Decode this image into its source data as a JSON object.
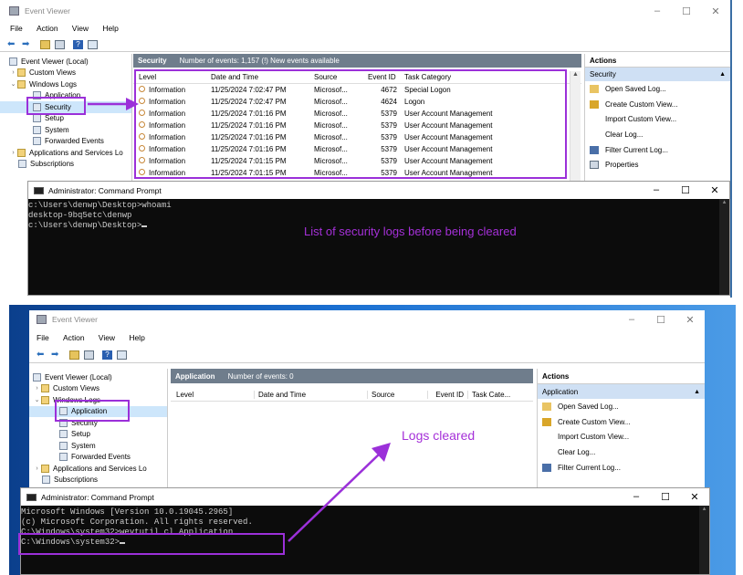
{
  "colors": {
    "accent": "#9b30d9",
    "panel_header": "#6f7d8c",
    "selected": "#cfe0f4",
    "desktop": "#1a6fd1"
  },
  "top": {
    "window_title": "Event Viewer",
    "menu": [
      "File",
      "Action",
      "View",
      "Help"
    ],
    "tree": [
      {
        "label": "Event Viewer (Local)",
        "level": 0
      },
      {
        "label": "Custom Views",
        "level": 1
      },
      {
        "label": "Windows Logs",
        "level": 1
      },
      {
        "label": "Application",
        "level": 2
      },
      {
        "label": "Security",
        "level": 2
      },
      {
        "label": "Setup",
        "level": 2
      },
      {
        "label": "System",
        "level": 2
      },
      {
        "label": "Forwarded Events",
        "level": 2
      },
      {
        "label": "Applications and Services Lo",
        "level": 1
      },
      {
        "label": "Subscriptions",
        "level": 1
      }
    ],
    "panel_name": "Security",
    "panel_info": "Number of events: 1,157 (!) New events available",
    "columns": [
      "Level",
      "Date and Time",
      "Source",
      "Event ID",
      "Task Category"
    ],
    "rows": [
      [
        "Information",
        "11/25/2024 7:02:47 PM",
        "Microsof...",
        "4672",
        "Special Logon"
      ],
      [
        "Information",
        "11/25/2024 7:02:47 PM",
        "Microsof...",
        "4624",
        "Logon"
      ],
      [
        "Information",
        "11/25/2024 7:01:16 PM",
        "Microsof...",
        "5379",
        "User Account Management"
      ],
      [
        "Information",
        "11/25/2024 7:01:16 PM",
        "Microsof...",
        "5379",
        "User Account Management"
      ],
      [
        "Information",
        "11/25/2024 7:01:16 PM",
        "Microsof...",
        "5379",
        "User Account Management"
      ],
      [
        "Information",
        "11/25/2024 7:01:16 PM",
        "Microsof...",
        "5379",
        "User Account Management"
      ],
      [
        "Information",
        "11/25/2024 7:01:15 PM",
        "Microsof...",
        "5379",
        "User Account Management"
      ],
      [
        "Information",
        "11/25/2024 7:01:15 PM",
        "Microsof...",
        "5379",
        "User Account Management"
      ]
    ],
    "actions_title": "Actions",
    "actions_section": "Security",
    "actions": [
      "Open Saved Log...",
      "Create Custom View...",
      "Import Custom View...",
      "Clear Log...",
      "Filter Current Log...",
      "Properties"
    ],
    "cmd_title": "Administrator: Command Prompt",
    "cmd_lines": [
      "",
      "c:\\Users\\denwp\\Desktop>whoami",
      "desktop-9bq5etc\\denwp",
      "",
      "c:\\Users\\denwp\\Desktop>"
    ],
    "annotation": "List of security logs before being cleared"
  },
  "bottom": {
    "window_title": "Event Viewer",
    "menu": [
      "File",
      "Action",
      "View",
      "Help"
    ],
    "tree": [
      {
        "label": "Event Viewer (Local)",
        "level": 0
      },
      {
        "label": "Custom Views",
        "level": 1
      },
      {
        "label": "Windows Logs",
        "level": 1
      },
      {
        "label": "Application",
        "level": 2
      },
      {
        "label": "Security",
        "level": 2
      },
      {
        "label": "Setup",
        "level": 2
      },
      {
        "label": "System",
        "level": 2
      },
      {
        "label": "Forwarded Events",
        "level": 2
      },
      {
        "label": "Applications and Services Lo",
        "level": 1
      },
      {
        "label": "Subscriptions",
        "level": 1
      }
    ],
    "panel_name": "Application",
    "panel_info": "Number of events: 0",
    "columns": [
      "Level",
      "Date and Time",
      "Source",
      "Event ID",
      "Task Cate..."
    ],
    "actions_title": "Actions",
    "actions_section": "Application",
    "actions": [
      "Open Saved Log...",
      "Create Custom View...",
      "Import Custom View...",
      "Clear Log...",
      "Filter Current Log..."
    ],
    "cmd_title": "Administrator: Command Prompt",
    "cmd_lines": [
      "Microsoft Windows [Version 10.0.19045.2965]",
      "(c) Microsoft Corporation. All rights reserved.",
      "",
      "C:\\Windows\\system32>wevtutil cl Application",
      "",
      "C:\\Windows\\system32>"
    ],
    "annotation": "Logs cleared"
  }
}
